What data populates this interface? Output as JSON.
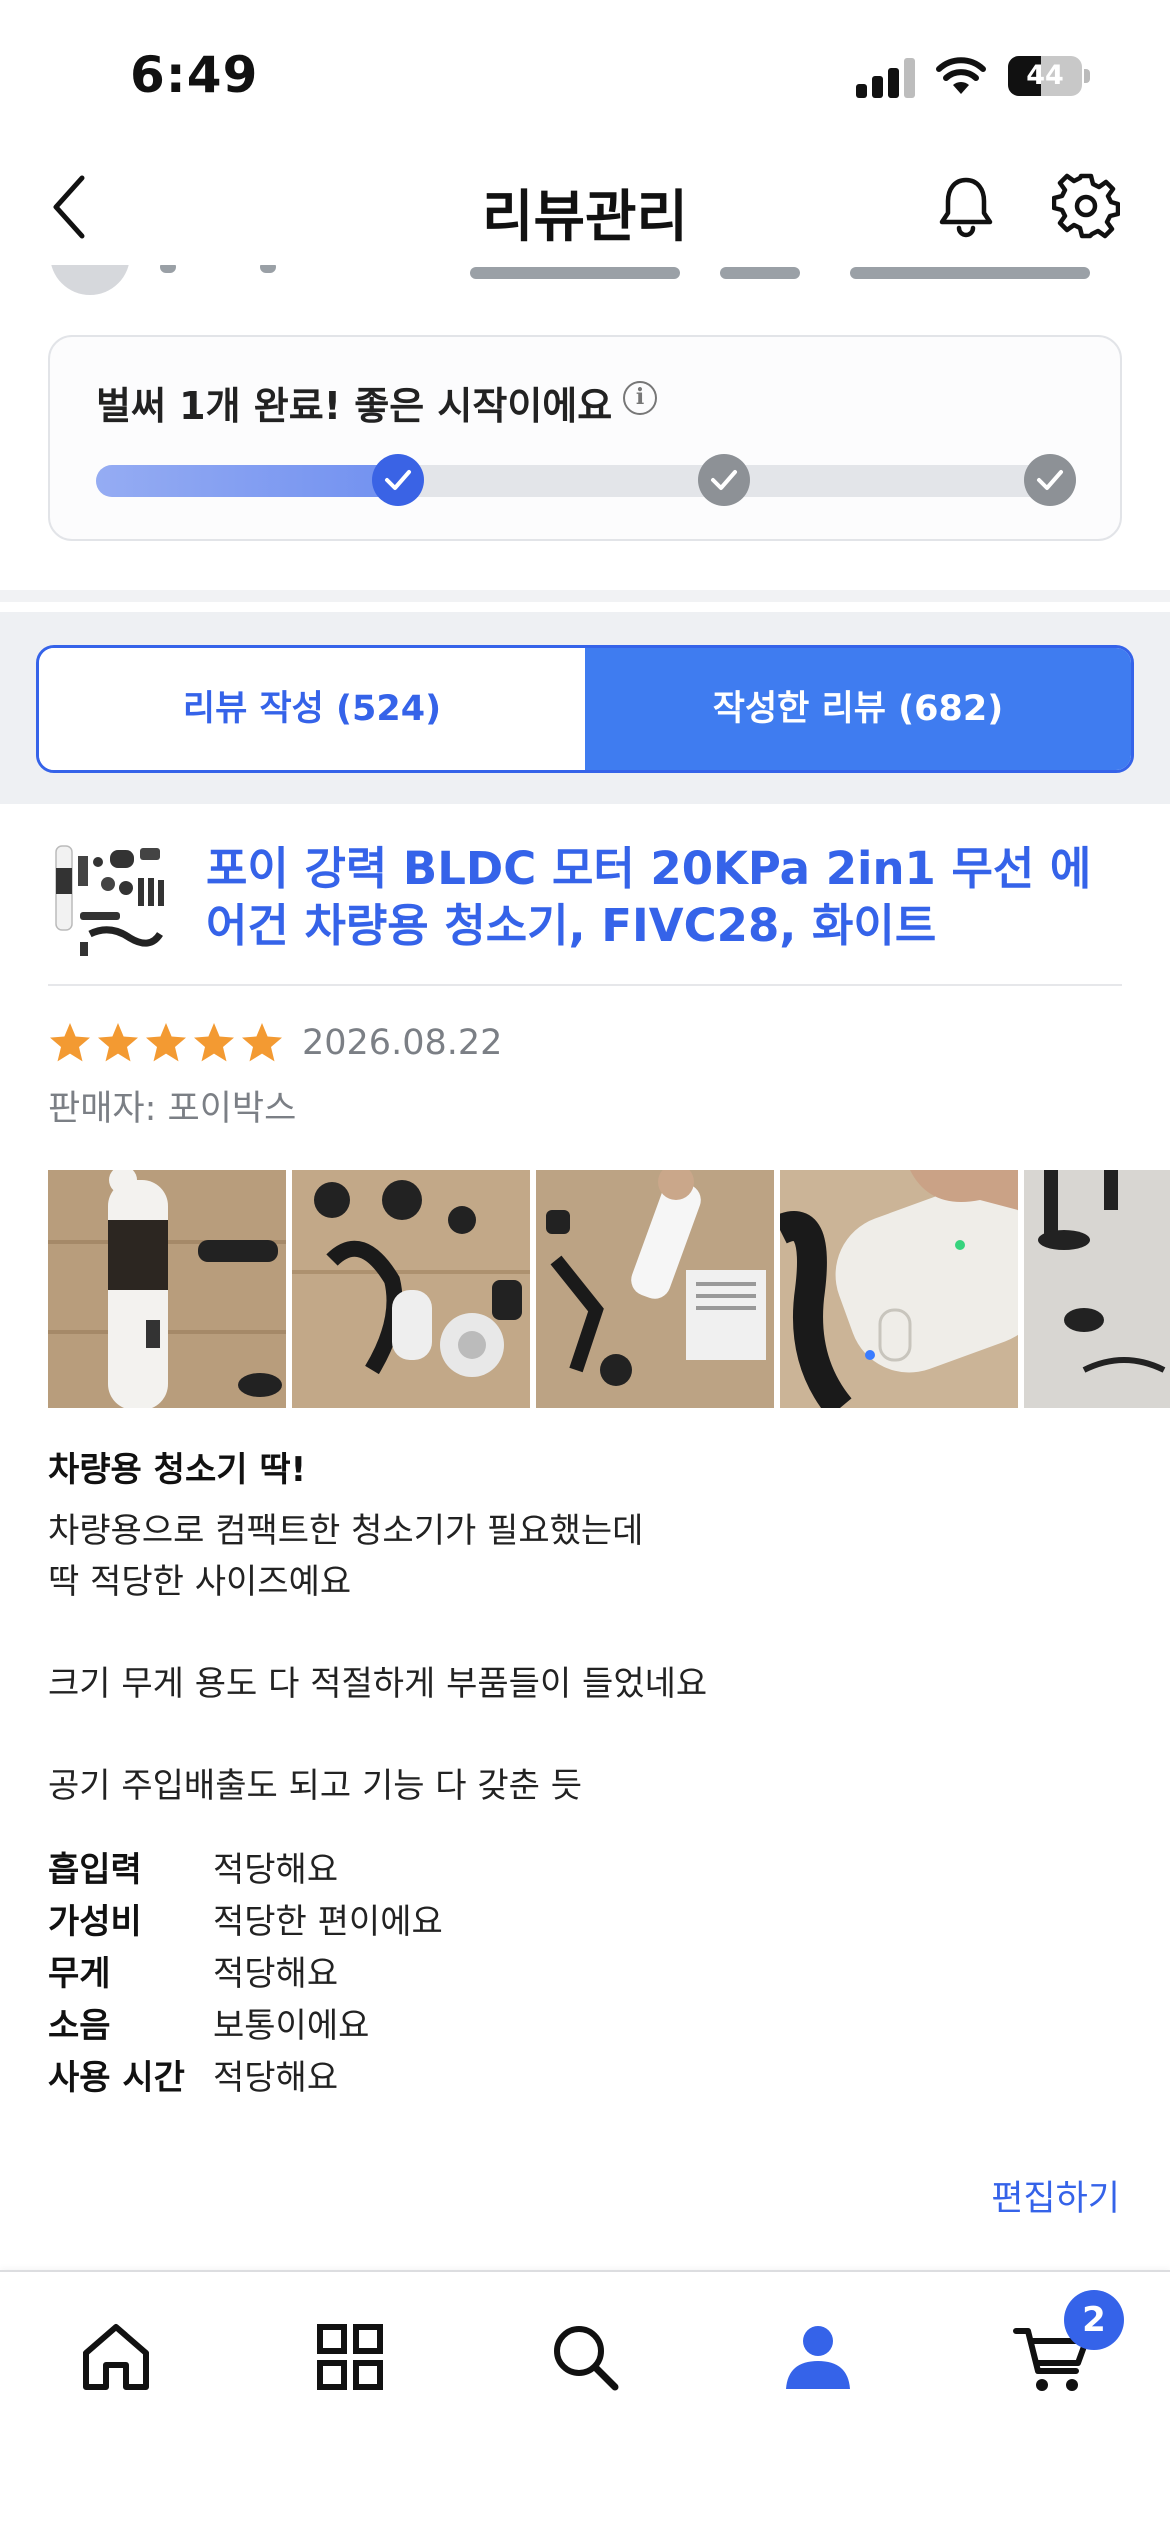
{
  "status_bar": {
    "time": "6:49",
    "battery": "44",
    "battery_level": 0.44
  },
  "header": {
    "title": "리뷰관리"
  },
  "progress": {
    "message": "벌써 1개 완료! 좋은 시작이에요",
    "completed_steps": 1,
    "total_steps": 3
  },
  "tabs": [
    {
      "label": "리뷰 작성 (524)",
      "active": false
    },
    {
      "label": "작성한 리뷰 (682)",
      "active": true
    }
  ],
  "product": {
    "name": "포이 강력 BLDC 모터 20KPa 2in1 무선 에어건 차량용 청소기, FIVC28, 화이트"
  },
  "review": {
    "rating": 5,
    "date": "2026.08.22",
    "seller": "판매자: 포이박스",
    "title": "차량용 청소기 딱!",
    "body": [
      "차량용으로 컴팩트한 청소기가 필요했는데",
      "딱 적당한 사이즈예요",
      "",
      "크기 무게 용도 다 적절하게 부품들이 들었네요",
      "",
      "공기 주입배출도 되고 기능 다 갖춘 듯"
    ],
    "attributes": [
      {
        "key": "흡입력",
        "value": "적당해요"
      },
      {
        "key": "가성비",
        "value": "적당한 편이에요"
      },
      {
        "key": "무게",
        "value": "적당해요"
      },
      {
        "key": "소음",
        "value": "보통이에요"
      },
      {
        "key": "사용 시간",
        "value": "적당해요"
      }
    ],
    "edit_label": "편집하기"
  },
  "tabbar": {
    "cart_count": "2",
    "active": "my-page"
  },
  "colors": {
    "accent": "#3563e9",
    "active_tab": "#3f7cf0",
    "star": "#f39a32"
  }
}
